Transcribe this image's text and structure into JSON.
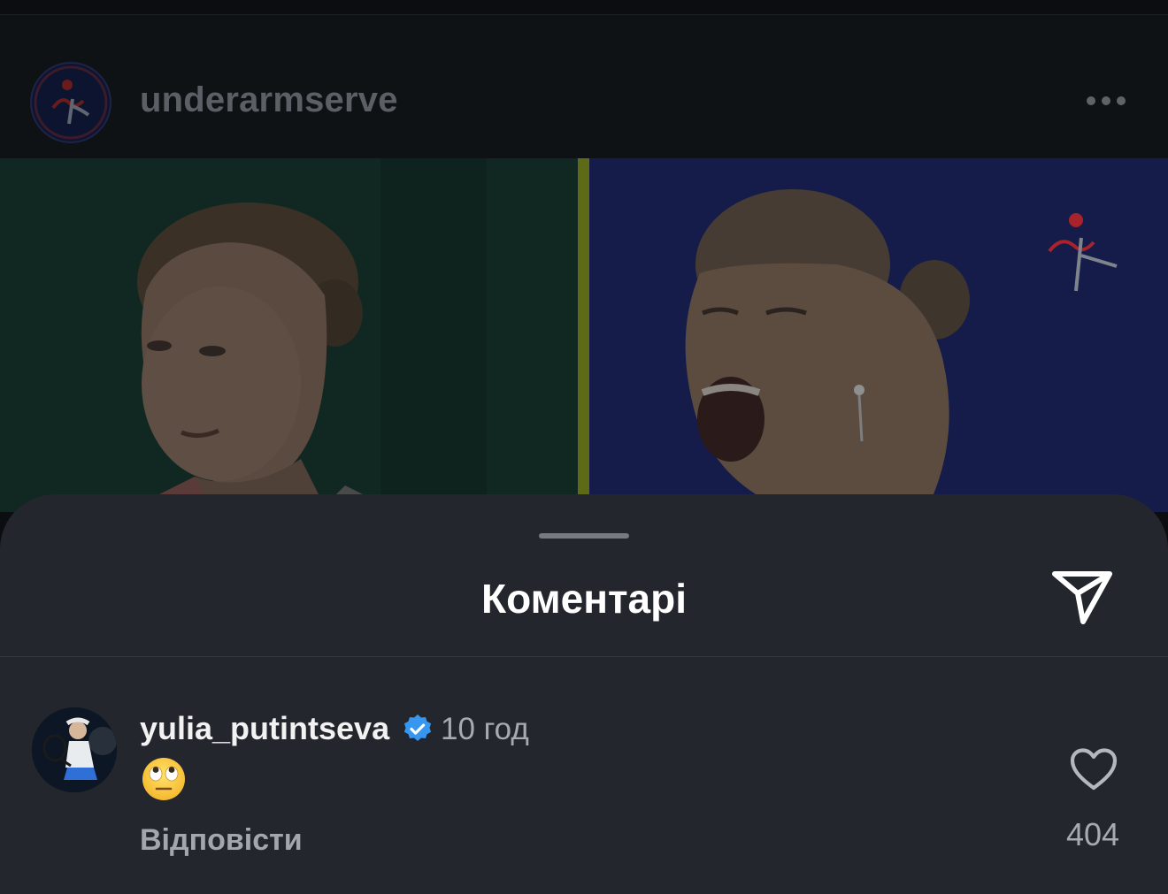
{
  "post": {
    "username": "underarmserve",
    "more_icon": "more-horizontal-icon",
    "image_alt": ""
  },
  "comments_sheet": {
    "title": "Коментарі",
    "share_icon": "paper-plane-icon",
    "comment": {
      "username": "yulia_putintseva",
      "verified": true,
      "time": "10 год",
      "text": "🙄",
      "reply_label": "Відповісти",
      "like_icon": "heart-outline-icon",
      "like_count": "404"
    }
  },
  "colors": {
    "sheet_bg": "#23262c",
    "verified_blue": "#3797f0",
    "muted_text": "#a7abb1"
  }
}
